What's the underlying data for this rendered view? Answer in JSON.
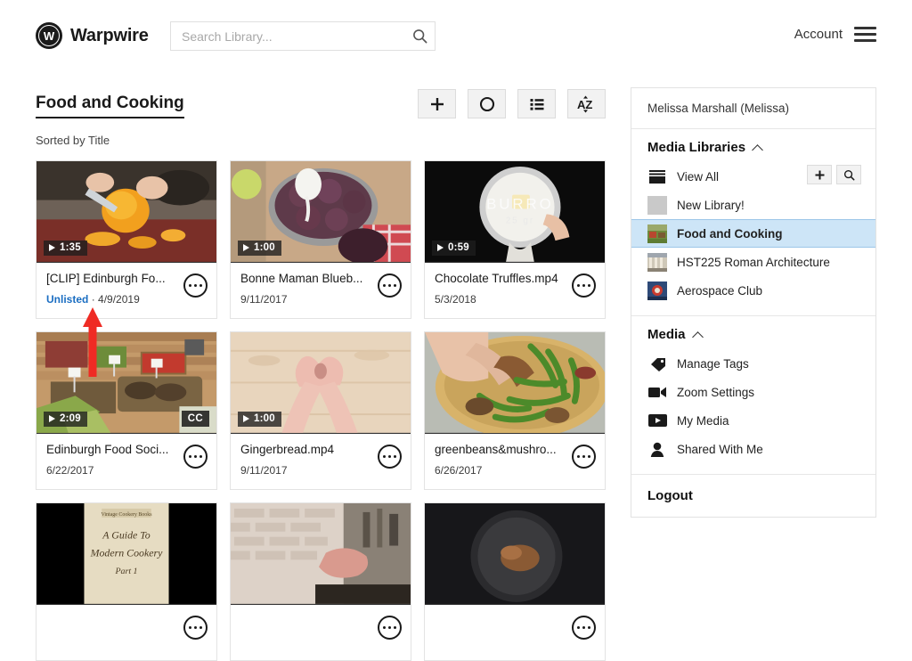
{
  "header": {
    "brand_name": "Warpwire",
    "logo_letter": "W",
    "search": {
      "placeholder": "Search Library...",
      "value": "",
      "icon": "search-icon"
    },
    "account_label": "Account",
    "menu_icon": "hamburger-icon"
  },
  "main": {
    "library_title": "Food and Cooking",
    "sorted_by": "Sorted by Title",
    "toolbar": [
      {
        "name": "add-media-button",
        "icon": "plus-icon",
        "label": "+"
      },
      {
        "name": "record-button",
        "icon": "circle-icon",
        "label": "O"
      },
      {
        "name": "list-view-button",
        "icon": "list-icon",
        "label": "List"
      },
      {
        "name": "sort-button",
        "icon": "sort-az-icon",
        "label": "AZ"
      }
    ],
    "cards": [
      {
        "title": "[CLIP] Edinburgh Fo...",
        "date": "4/9/2019",
        "status": "Unlisted",
        "duration": "1:35",
        "cc": false,
        "art": "chef-peeling-squash"
      },
      {
        "title": "Bonne Maman Blueb...",
        "date": "9/11/2017",
        "status": "",
        "duration": "1:00",
        "cc": false,
        "art": "blueberry-rolls-pan"
      },
      {
        "title": "Chocolate Truffles.mp4",
        "date": "5/3/2018",
        "status": "",
        "duration": "0:59",
        "cc": false,
        "art": "butter-in-pot-dark"
      },
      {
        "title": "Edinburgh Food Soci...",
        "date": "6/22/2017",
        "status": "",
        "duration": "2:09",
        "cc": true,
        "cc_label": "CC",
        "art": "market-produce-stall"
      },
      {
        "title": "Gingerbread.mp4",
        "date": "9/11/2017",
        "status": "",
        "duration": "1:00",
        "cc": false,
        "art": "hands-on-wood-table"
      },
      {
        "title": "greenbeans&mushro...",
        "date": "6/26/2017",
        "status": "",
        "duration": "",
        "cc": false,
        "art": "green-beans-skillet"
      },
      {
        "title": "",
        "date": "",
        "status": "",
        "duration": "",
        "cc": false,
        "art": "cookery-book-cover"
      },
      {
        "title": "",
        "date": "",
        "status": "",
        "duration": "",
        "cc": false,
        "art": "kitchen-brick-wall"
      },
      {
        "title": "",
        "date": "",
        "status": "",
        "duration": "",
        "cc": false,
        "art": "dark-pan-food"
      }
    ]
  },
  "sidebar": {
    "user": "Melissa Marshall (Melissa)",
    "media_libraries": {
      "heading": "Media Libraries",
      "collapse_icon": "chevron-up-icon",
      "add_button_icon": "plus-icon",
      "search_button_icon": "search-icon",
      "items": [
        {
          "label": "View All",
          "icon": "library-stack-icon",
          "selected": false
        },
        {
          "label": "New Library!",
          "icon": "blank-thumb",
          "selected": false
        },
        {
          "label": "Food and Cooking",
          "icon": "library-thumb-food",
          "selected": true
        },
        {
          "label": "HST225 Roman Architecture",
          "icon": "library-thumb-architecture",
          "selected": false
        },
        {
          "label": "Aerospace Club",
          "icon": "library-thumb-aerospace",
          "selected": false
        }
      ]
    },
    "media": {
      "heading": "Media",
      "collapse_icon": "chevron-up-icon",
      "items": [
        {
          "label": "Manage Tags",
          "icon": "tag-icon"
        },
        {
          "label": "Zoom Settings",
          "icon": "video-camera-icon"
        },
        {
          "label": "My Media",
          "icon": "play-rect-icon"
        },
        {
          "label": "Shared With Me",
          "icon": "person-icon"
        }
      ]
    },
    "logout_label": "Logout"
  },
  "annotation": {
    "arrow_icon": "red-up-arrow",
    "color": "#ef2b24"
  },
  "colors": {
    "accent_blue": "#1b6ec2",
    "selection_blue": "#cde5f7",
    "annotation_red": "#ef2b24",
    "toolbar_gray": "#f2f2f2",
    "text_dark": "#1a1a1a"
  }
}
